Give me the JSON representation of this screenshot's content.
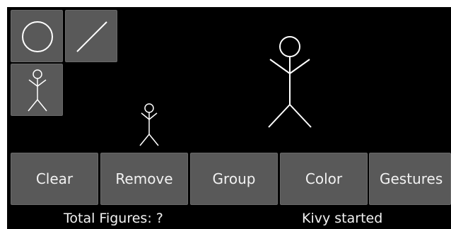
{
  "toolbox": {
    "tools": [
      {
        "icon": "circle-icon"
      },
      {
        "icon": "line-icon"
      },
      {
        "icon": "stick-figure-icon"
      }
    ]
  },
  "canvas": {
    "figures": [
      {
        "icon": "stick-figure-icon"
      },
      {
        "icon": "stick-figure-icon"
      }
    ]
  },
  "buttons": {
    "clear": "Clear",
    "remove": "Remove",
    "group": "Group",
    "color": "Color",
    "gestures": "Gestures"
  },
  "status": {
    "figures": "Total Figures: ?",
    "message": "Kivy started"
  },
  "colors": {
    "background": "#000000",
    "button": "#595959",
    "text": "#f2f2f2",
    "stroke": "#ffffff"
  }
}
